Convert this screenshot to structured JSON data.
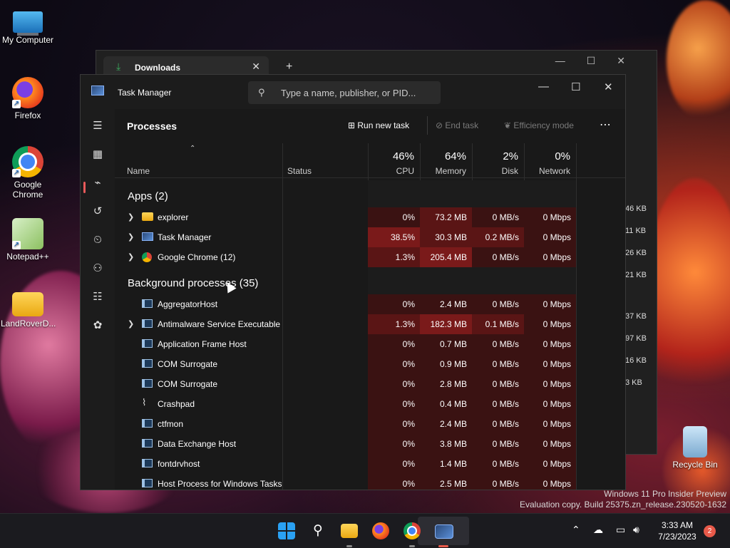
{
  "desktop": {
    "icons": [
      {
        "label": "My Computer",
        "icon": "computer-icon"
      },
      {
        "label": "Firefox",
        "icon": "firefox-icon"
      },
      {
        "label": "Google Chrome",
        "icon": "chrome-icon"
      },
      {
        "label": "Notepad++",
        "icon": "notepadpp-icon"
      },
      {
        "label": "LandRoverD...",
        "icon": "folder-icon"
      },
      {
        "label": "Recycle Bin",
        "icon": "recycle-bin-icon"
      }
    ],
    "watermark_line1": "Windows 11 Pro Insider Preview",
    "watermark_line2": "Evaluation copy. Build 25375.zn_release.230520-1632"
  },
  "downloads_window": {
    "tab_title": "Downloads",
    "sizes": [
      "46 KB",
      "11 KB",
      "26 KB",
      "21 KB",
      "37 KB",
      "97 KB",
      "16 KB",
      "3 KB"
    ]
  },
  "task_manager": {
    "title": "Task Manager",
    "search_placeholder": "Type a name, publisher, or PID...",
    "heading": "Processes",
    "run_new_task": "Run new task",
    "end_task": "End task",
    "efficiency_mode": "Efficiency mode",
    "columns": {
      "name": "Name",
      "status": "Status",
      "cpu_pct": "46%",
      "cpu": "CPU",
      "mem_pct": "64%",
      "mem": "Memory",
      "disk_pct": "2%",
      "disk": "Disk",
      "net_pct": "0%",
      "net": "Network"
    },
    "apps_title": "Apps (2)",
    "apps": [
      {
        "name": "explorer",
        "icon": "folder",
        "cpu": "0%",
        "mem": "73.2 MB",
        "disk": "0 MB/s",
        "net": "0 Mbps"
      },
      {
        "name": "Task Manager",
        "icon": "taskmgr",
        "cpu": "38.5%",
        "mem": "30.3 MB",
        "disk": "0.2 MB/s",
        "net": "0 Mbps"
      },
      {
        "name": "Google Chrome (12)",
        "icon": "chrome",
        "cpu": "1.3%",
        "mem": "205.4 MB",
        "disk": "0 MB/s",
        "net": "0 Mbps"
      }
    ],
    "bg_title": "Background processes (35)",
    "background": [
      {
        "name": "AggregatorHost",
        "icon": "sys",
        "expand": false,
        "cpu": "0%",
        "mem": "2.4 MB",
        "disk": "0 MB/s",
        "net": "0 Mbps"
      },
      {
        "name": "Antimalware Service Executable",
        "icon": "sys",
        "expand": true,
        "cpu": "1.3%",
        "mem": "182.3 MB",
        "disk": "0.1 MB/s",
        "net": "0 Mbps"
      },
      {
        "name": "Application Frame Host",
        "icon": "sys",
        "expand": false,
        "cpu": "0%",
        "mem": "0.7 MB",
        "disk": "0 MB/s",
        "net": "0 Mbps"
      },
      {
        "name": "COM Surrogate",
        "icon": "sys",
        "expand": false,
        "cpu": "0%",
        "mem": "0.9 MB",
        "disk": "0 MB/s",
        "net": "0 Mbps"
      },
      {
        "name": "COM Surrogate",
        "icon": "sys",
        "expand": false,
        "cpu": "0%",
        "mem": "2.8 MB",
        "disk": "0 MB/s",
        "net": "0 Mbps"
      },
      {
        "name": "Crashpad",
        "icon": "crash",
        "expand": false,
        "cpu": "0%",
        "mem": "0.4 MB",
        "disk": "0 MB/s",
        "net": "0 Mbps"
      },
      {
        "name": "ctfmon",
        "icon": "sys",
        "expand": false,
        "cpu": "0%",
        "mem": "2.4 MB",
        "disk": "0 MB/s",
        "net": "0 Mbps"
      },
      {
        "name": "Data Exchange Host",
        "icon": "sys",
        "expand": false,
        "cpu": "0%",
        "mem": "3.8 MB",
        "disk": "0 MB/s",
        "net": "0 Mbps"
      },
      {
        "name": "fontdrvhost",
        "icon": "sys",
        "expand": false,
        "cpu": "0%",
        "mem": "1.4 MB",
        "disk": "0 MB/s",
        "net": "0 Mbps"
      },
      {
        "name": "Host Process for Windows Tasks",
        "icon": "sys",
        "expand": false,
        "cpu": "0%",
        "mem": "2.5 MB",
        "disk": "0 MB/s",
        "net": "0 Mbps"
      }
    ]
  },
  "taskbar": {
    "time": "3:33 AM",
    "date": "7/23/2023",
    "notification_count": "2"
  },
  "colors": {
    "heat_high": "#7a1a1a",
    "heat_med": "#5a1515",
    "heat_low": "#3a1212",
    "accent_red": "#e85a5a"
  }
}
